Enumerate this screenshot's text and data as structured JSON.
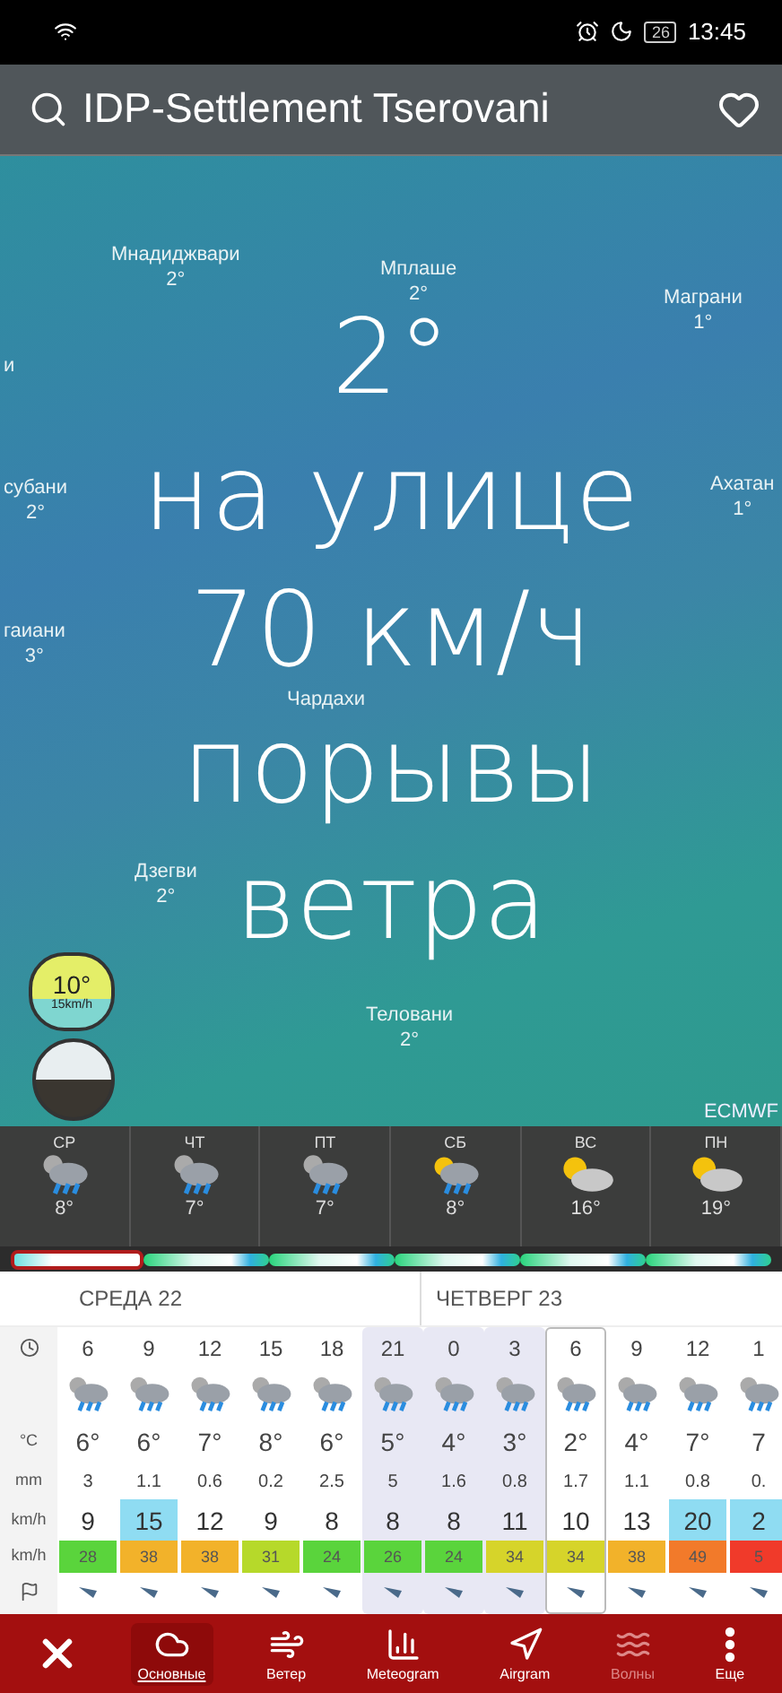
{
  "status_bar": {
    "battery": "26",
    "time": "13:45"
  },
  "search": {
    "value": "IDP-Settlement Tserovani"
  },
  "map": {
    "labels": [
      {
        "name": "Мнадиджвари",
        "temp": "2°"
      },
      {
        "name": "Мплаше",
        "temp": "2°"
      },
      {
        "name": "Маграни",
        "temp": "1°"
      },
      {
        "name": "и"
      },
      {
        "name": "субани",
        "temp": "2°"
      },
      {
        "name": "Ахатан",
        "temp": "1°"
      },
      {
        "name": "гаиани",
        "temp": "3°"
      },
      {
        "name": "Чардахи"
      },
      {
        "name": "Дзегви",
        "temp": "2°"
      },
      {
        "name": "Теловани",
        "temp": "2°"
      }
    ],
    "overlay": [
      "2°",
      "на улице",
      "70 км/ч",
      "порывы",
      "ветра"
    ],
    "badge": {
      "temp": "10°",
      "wind": "15km/h"
    },
    "source": "ECMWF"
  },
  "days": [
    {
      "label": "СР",
      "temp": "8°",
      "kind": "rain",
      "selected": true
    },
    {
      "label": "ЧТ",
      "temp": "7°",
      "kind": "rain",
      "selected": false
    },
    {
      "label": "ПТ",
      "temp": "7°",
      "kind": "rain",
      "selected": false
    },
    {
      "label": "СБ",
      "temp": "8°",
      "kind": "sunrain",
      "selected": false
    },
    {
      "label": "ВС",
      "temp": "16°",
      "kind": "suncloud",
      "selected": false
    },
    {
      "label": "ПН",
      "temp": "19°",
      "kind": "suncloud",
      "selected": false
    }
  ],
  "hourly": {
    "day_headers": [
      "СРЕДА 22",
      "ЧЕТВЕРГ 23"
    ],
    "row_labels": [
      "°C",
      "mm",
      "km/h",
      "km/h"
    ],
    "columns": [
      {
        "time": "6",
        "temp": "6°",
        "mm": "3",
        "wind": {
          "value": "9"
        },
        "gust": {
          "value": "28",
          "color": "#5ad43c"
        },
        "night": false,
        "selected": false
      },
      {
        "time": "9",
        "temp": "6°",
        "mm": "1.1",
        "wind": {
          "value": "15",
          "color": "#8fdcf2"
        },
        "gust": {
          "value": "38",
          "color": "#f2b22a"
        },
        "night": false,
        "selected": false
      },
      {
        "time": "12",
        "temp": "7°",
        "mm": "0.6",
        "wind": {
          "value": "12"
        },
        "gust": {
          "value": "38",
          "color": "#f2b22a"
        },
        "night": false,
        "selected": false
      },
      {
        "time": "15",
        "temp": "8°",
        "mm": "0.2",
        "wind": {
          "value": "9"
        },
        "gust": {
          "value": "31",
          "color": "#b6d92a"
        },
        "night": false,
        "selected": false
      },
      {
        "time": "18",
        "temp": "6°",
        "mm": "2.5",
        "wind": {
          "value": "8"
        },
        "gust": {
          "value": "24",
          "color": "#5ad43c"
        },
        "night": false,
        "selected": false
      },
      {
        "time": "21",
        "temp": "5°",
        "mm": "5",
        "wind": {
          "value": "8"
        },
        "gust": {
          "value": "26",
          "color": "#5ad43c"
        },
        "night": true,
        "selected": false
      },
      {
        "time": "0",
        "temp": "4°",
        "mm": "1.6",
        "wind": {
          "value": "8"
        },
        "gust": {
          "value": "24",
          "color": "#5ad43c"
        },
        "night": true,
        "selected": false
      },
      {
        "time": "3",
        "temp": "3°",
        "mm": "0.8",
        "wind": {
          "value": "11"
        },
        "gust": {
          "value": "34",
          "color": "#d6d42a"
        },
        "night": true,
        "selected": false
      },
      {
        "time": "6",
        "temp": "2°",
        "mm": "1.7",
        "wind": {
          "value": "10"
        },
        "gust": {
          "value": "34",
          "color": "#d6d42a"
        },
        "night": false,
        "selected": true
      },
      {
        "time": "9",
        "temp": "4°",
        "mm": "1.1",
        "wind": {
          "value": "13"
        },
        "gust": {
          "value": "38",
          "color": "#f2b22a"
        },
        "night": false,
        "selected": false
      },
      {
        "time": "12",
        "temp": "7°",
        "mm": "0.8",
        "wind": {
          "value": "20",
          "color": "#8fdcf2"
        },
        "gust": {
          "value": "49",
          "color": "#f27a2a"
        },
        "night": false,
        "selected": false
      },
      {
        "time": "1",
        "temp": "7",
        "mm": "0.",
        "wind": {
          "value": "2",
          "color": "#8fdcf2"
        },
        "gust": {
          "value": "5",
          "color": "#f03a2a"
        },
        "night": false,
        "selected": false
      }
    ]
  },
  "nav": [
    {
      "kind": "basic",
      "label": "Основные",
      "selected": true,
      "disabled": false
    },
    {
      "kind": "wind",
      "label": "Ветер",
      "selected": false,
      "disabled": false
    },
    {
      "kind": "meteogram",
      "label": "Meteogram",
      "selected": false,
      "disabled": false
    },
    {
      "kind": "airgram",
      "label": "Airgram",
      "selected": false,
      "disabled": false
    },
    {
      "kind": "waves",
      "label": "Волны",
      "selected": false,
      "disabled": true
    },
    {
      "kind": "more",
      "label": "Еще",
      "selected": false,
      "disabled": false
    }
  ]
}
